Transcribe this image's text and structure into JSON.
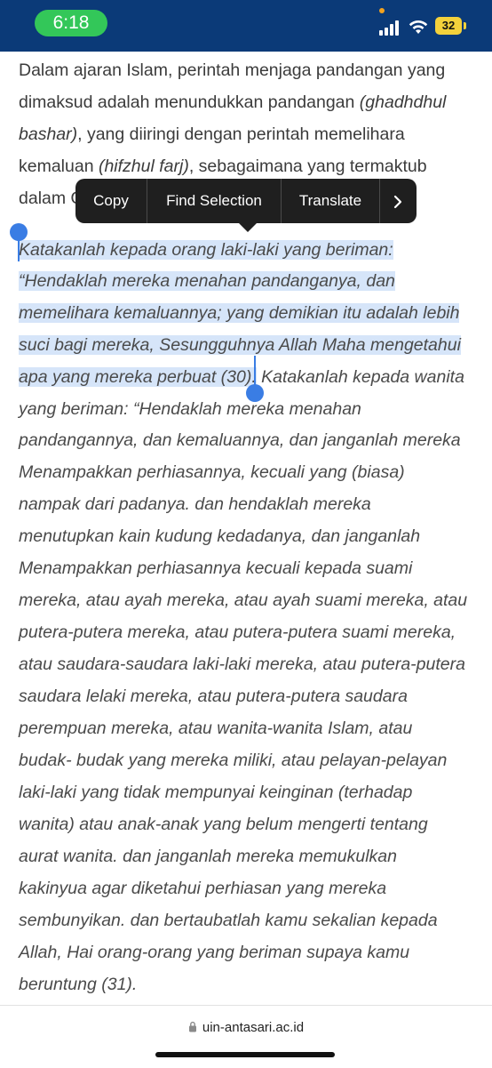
{
  "status": {
    "time": "6:18",
    "battery": "32",
    "signal_icon": "cellular-signal-icon",
    "wifi_icon": "wifi-icon",
    "accent_time_pill": "#33c759",
    "status_bar_color": "#0b3a78"
  },
  "article": {
    "line1": "Dalam ajaran Islam, perintah menjaga pandangan yang",
    "line2a": "dimaksud adalah menundukkan pandangan ",
    "line2b": "(ghadhdhul",
    "line3a": "bashar)",
    "line3b": ", yang diiringi dengan perintah memelihara",
    "line4a": "kemaluan ",
    "line4b": "(hifzhul farj)",
    "line4c": ", sebagaimana yang termaktub",
    "line5": "dalam Q",
    "sel1": "Katakanlah kepada orang laki-laki yang beriman:",
    "sel2": "“Hendaklah mereka menahan pandanganya, dan",
    "sel3": "memelihara kemaluannya; yang demikian itu adalah lebih",
    "sel4": "suci bagi mereka, Sesungguhnya Allah Maha mengetahui",
    "sel5": "apa yang mereka perbuat (30).",
    "q5b": " Katakanlah kepada wanita",
    "q6": "yang beriman: “Hendaklah mereka menahan",
    "q7": "pandangannya, dan kemaluannya, dan janganlah mereka",
    "q8": "Menampakkan perhiasannya, kecuali yang (biasa)",
    "q9": "nampak dari padanya. dan hendaklah mereka",
    "q10": "menutupkan kain kudung kedadanya, dan janganlah",
    "q11": "Menampakkan perhiasannya kecuali kepada suami",
    "q12": "mereka, atau ayah mereka, atau ayah suami mereka, atau",
    "q13": "putera-putera mereka, atau putera-putera suami mereka,",
    "q14": "atau saudara-saudara laki-laki mereka, atau putera-putera",
    "q15": "saudara lelaki mereka, atau putera-putera saudara",
    "q16": "perempuan mereka, atau wanita-wanita Islam, atau",
    "q17": "budak- budak yang mereka miliki, atau pelayan-pelayan",
    "q18": "laki-laki yang tidak mempunyai keinginan (terhadap",
    "q19": "wanita) atau anak-anak yang belum mengerti tentang",
    "q20": "aurat wanita. dan janganlah mereka memukulkan",
    "q21": "kakinyua agar diketahui perhiasan yang mereka",
    "q22": "sembunyikan. dan bertaubatlah kamu sekalian kepada",
    "q23": "Allah, Hai orang-orang yang beriman supaya kamu",
    "q24": "beruntung (31)."
  },
  "context_menu": {
    "copy": "Copy",
    "find": "Find Selection",
    "translate": "Translate",
    "more_icon": "chevron-right-icon"
  },
  "selection_color": "#d6e5f9",
  "handle_color": "#3a7de4",
  "address_bar": {
    "lock_icon": "lock-icon",
    "url": "uin-antasari.ac.id"
  }
}
